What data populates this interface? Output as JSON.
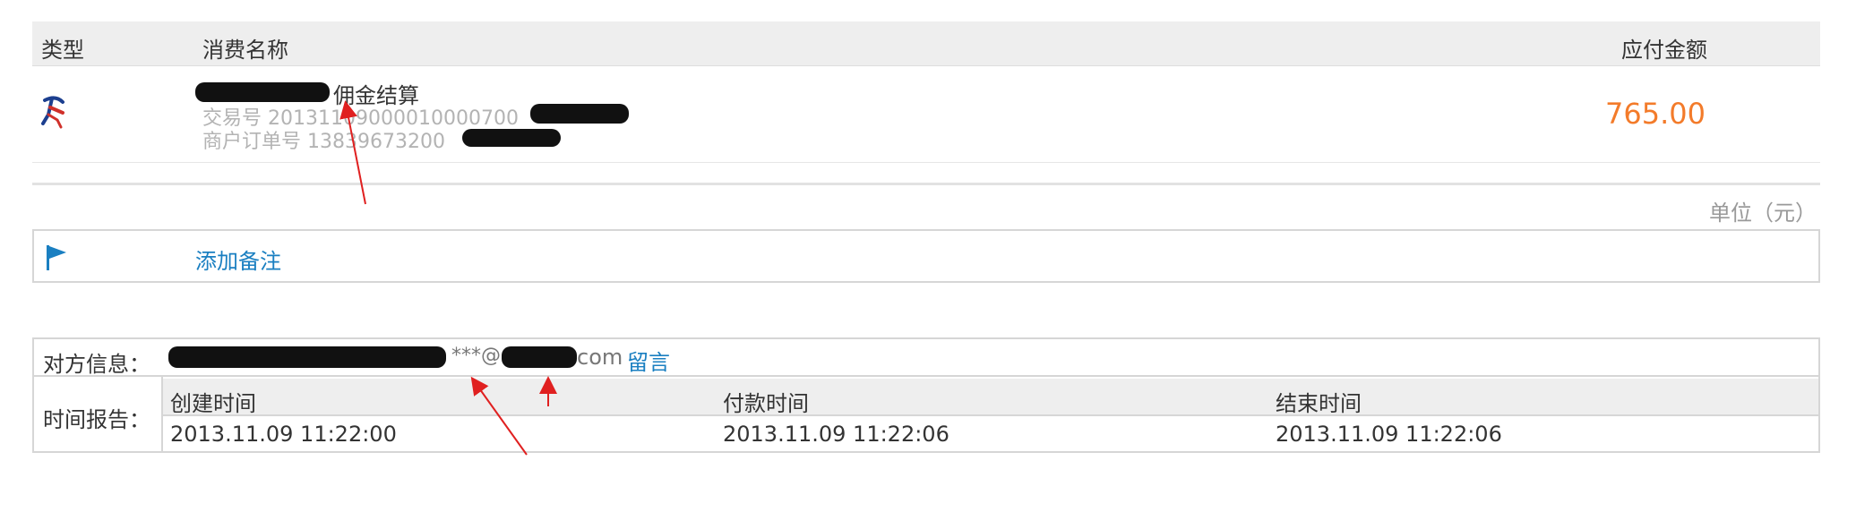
{
  "order_table": {
    "headers": {
      "type": "类型",
      "name": "消费名称",
      "amount": "应付金额"
    },
    "item": {
      "name_suffix": "佣金结算",
      "trade_label": "交易号",
      "trade_no": "20131109000010000700",
      "merchant_label": "商户订单号",
      "merchant_no": "13839673200",
      "amount": "765.00"
    },
    "unit_note": "单位（元）"
  },
  "remark": {
    "add_label": "添加备注"
  },
  "info": {
    "counterparty_label": "对方信息：",
    "email_fragment_a": "***@",
    "email_fragment_b": "com",
    "message_link": "留言",
    "time_report_label": "时间报告：",
    "time_columns": [
      {
        "head": "创建时间",
        "value": "2013.11.09 11:22:00"
      },
      {
        "head": "付款时间",
        "value": "2013.11.09 11:22:06"
      },
      {
        "head": "结束时间",
        "value": "2013.11.09 11:22:06"
      }
    ]
  },
  "colors": {
    "accent_link": "#1a7fc1",
    "amount": "#f37b2a",
    "arrow": "#e02020"
  },
  "icons": {
    "type_icon": "runner-icon",
    "remark_icon": "flag-icon"
  }
}
